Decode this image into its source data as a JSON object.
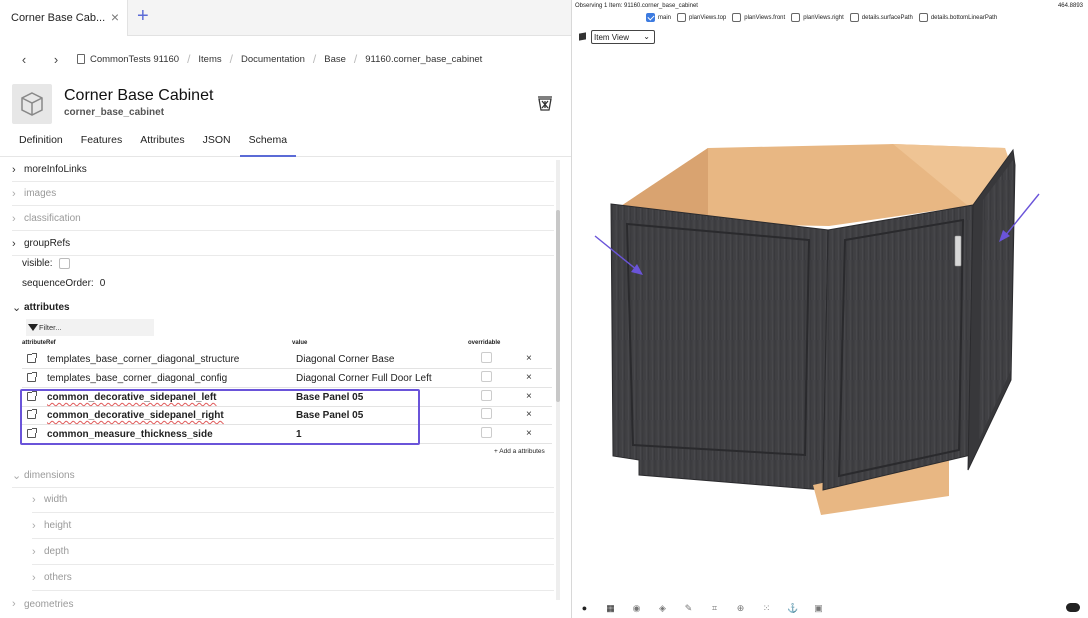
{
  "tab": {
    "label": "Corner Base Cab...",
    "close": "×",
    "add": "+"
  },
  "breadcrumb": [
    "CommonTests 91160",
    "Items",
    "Documentation",
    "Base",
    "91160.corner_base_cabinet"
  ],
  "nav": {
    "back": "‹",
    "forward": "›"
  },
  "item": {
    "title": "Corner Base Cabinet",
    "subtitle": "corner_base_cabinet"
  },
  "subtabs": [
    "Definition",
    "Features",
    "Attributes",
    "JSON",
    "Schema"
  ],
  "active_subtab": "Schema",
  "tree": {
    "moreInfoLinks": "moreInfoLinks",
    "images": "images",
    "classification": "classification",
    "groupRefs": "groupRefs",
    "visible_label": "visible:",
    "sequenceOrder_label": "sequenceOrder:",
    "sequenceOrder_value": "0",
    "attributes": "attributes",
    "filter_placeholder": "Filter...",
    "dimensions": "dimensions",
    "width": "width",
    "height": "height",
    "depth": "depth",
    "others": "others",
    "geometries": "geometries"
  },
  "attr_table": {
    "headers": {
      "ref": "attributeRef",
      "value": "value",
      "overridable": "overridable"
    },
    "rows": [
      {
        "ref": "templates_base_corner_diagonal_structure",
        "value": "Diagonal Corner Base",
        "remove": "×"
      },
      {
        "ref": "templates_base_corner_diagonal_config",
        "value": "Diagonal Corner Full Door Left",
        "remove": "×"
      },
      {
        "ref": "common_decorative_sidepanel_left",
        "value": "Base Panel 05",
        "remove": "×"
      },
      {
        "ref": "common_decorative_sidepanel_right",
        "value": "Base Panel 05",
        "remove": "×"
      },
      {
        "ref": "common_measure_thickness_side",
        "value": "1",
        "remove": "×"
      }
    ],
    "add_label": "+ Add a attributes"
  },
  "viewer": {
    "observing": "Observing 1 Item: 91160.corner_base_cabinet",
    "count": "464.8893",
    "views": [
      {
        "label": "main",
        "checked": true
      },
      {
        "label": "planViews.top",
        "checked": false
      },
      {
        "label": "planViews.front",
        "checked": false
      },
      {
        "label": "planViews.right",
        "checked": false
      },
      {
        "label": "details.surfacePath",
        "checked": false
      },
      {
        "label": "details.bottomLinearPath",
        "checked": false
      }
    ],
    "view_select": "Item View",
    "colors": {
      "cabinet": "#3f3f42",
      "interior": "#e8b783",
      "arrow": "#6a54d9",
      "accent": "#5b6bd6"
    }
  },
  "toolbar_icons": [
    "palette-icon",
    "grid-icon",
    "compass-icon",
    "cube-icon",
    "brush-icon",
    "frame-icon",
    "target-icon",
    "dots-icon",
    "anchor-icon",
    "layers-icon"
  ]
}
